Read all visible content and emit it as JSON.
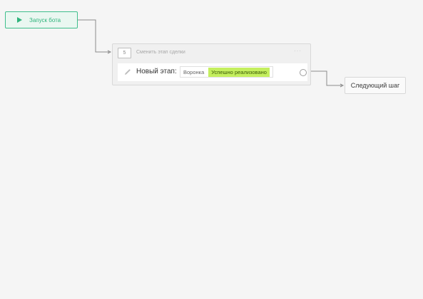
{
  "start": {
    "label": "Запуск бота",
    "icon": "play-icon"
  },
  "step": {
    "number": "5",
    "title": "Сменить этап сделки",
    "menu": "···",
    "row": {
      "label": "Новый этап:",
      "funnel": "Воронка",
      "stage": "Успешно реализовано",
      "stage_color": "#c4ef5e"
    }
  },
  "next": {
    "label": "Следующий шаг"
  },
  "colors": {
    "accent": "#2fb47c",
    "canvas": "#f5f5f5",
    "connector": "#8a8a8a"
  }
}
